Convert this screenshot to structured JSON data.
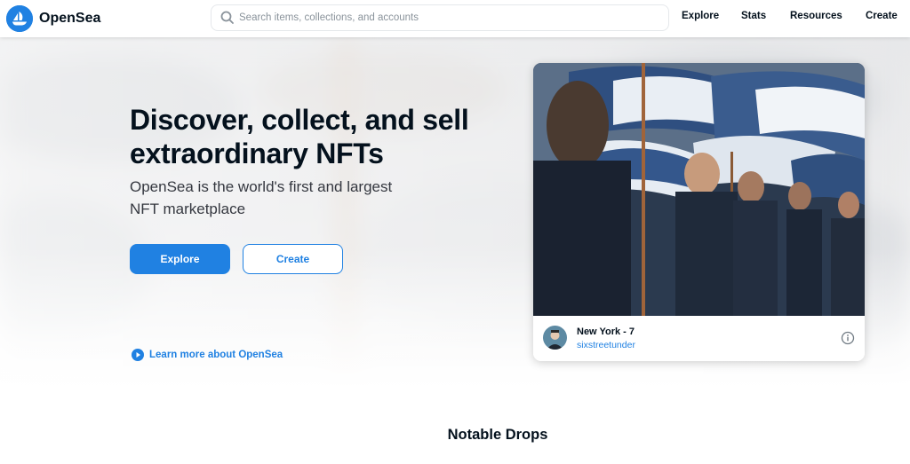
{
  "header": {
    "brand_name": "OpenSea",
    "search_placeholder": "Search items, collections, and accounts",
    "nav": [
      "Explore",
      "Stats",
      "Resources",
      "Create"
    ]
  },
  "hero": {
    "title": "Discover, collect, and sell extraordinary NFTs",
    "subtitle": "OpenSea is the world's first and largest NFT marketplace",
    "explore_label": "Explore",
    "create_label": "Create",
    "learn_more": "Learn more about OpenSea"
  },
  "featured_card": {
    "title": "New York - 7",
    "creator": "sixstreetunder"
  },
  "section": {
    "notable_drops": "Notable Drops"
  },
  "colors": {
    "accent": "#2081e2",
    "text_primary": "#04111d"
  },
  "icons": [
    "opensea-logo",
    "search-icon",
    "play-circle-icon",
    "info-icon"
  ]
}
